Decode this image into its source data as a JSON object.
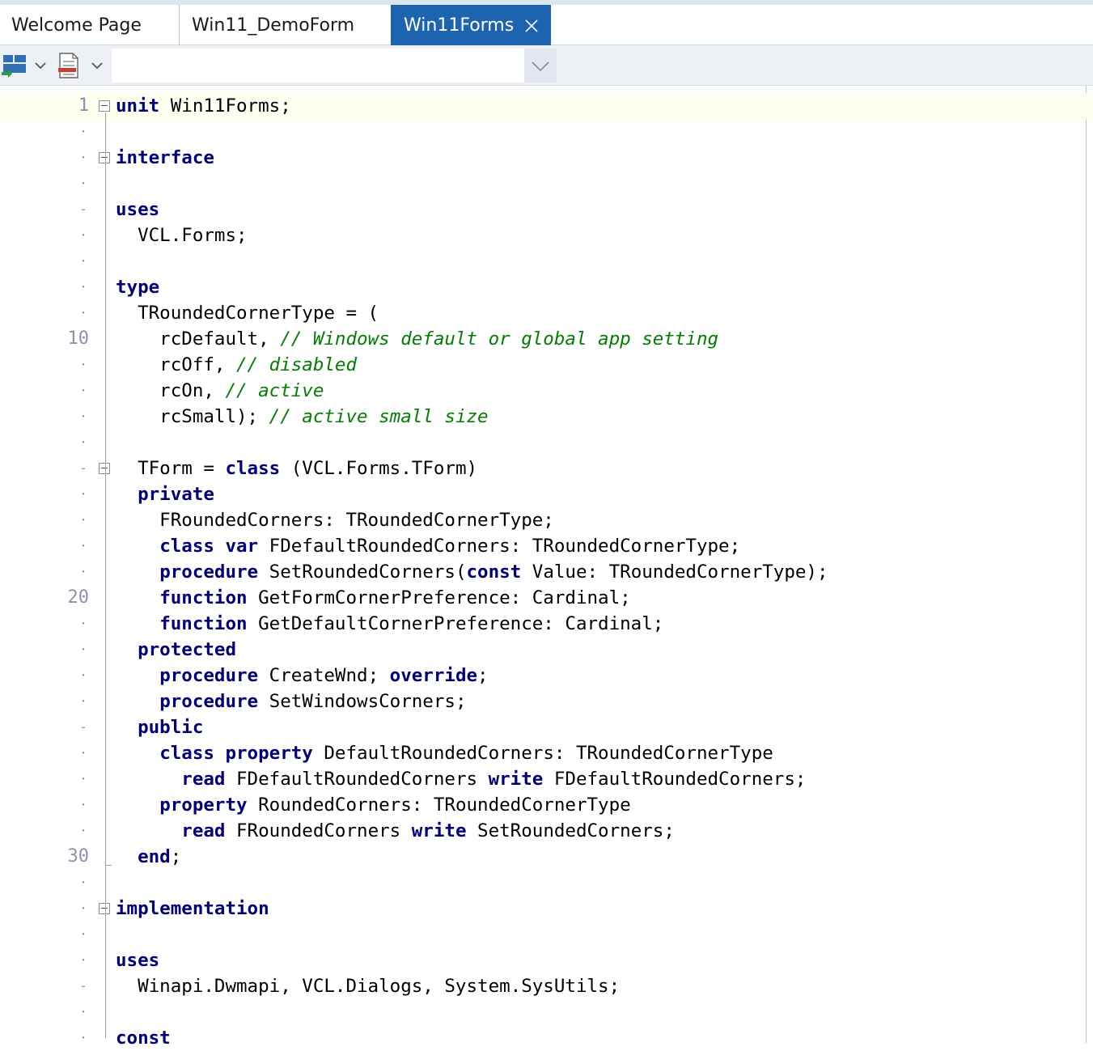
{
  "tabs": [
    {
      "label": "Welcome Page",
      "active": false
    },
    {
      "label": "Win11_DemoForm",
      "active": false
    },
    {
      "label": "Win11Forms",
      "active": true,
      "closable": true
    }
  ],
  "toolbar": {
    "buttons": [
      {
        "icon": "layout-icon",
        "dropdown": true
      },
      {
        "icon": "document-icon",
        "dropdown": true
      }
    ],
    "combo_value": ""
  },
  "editor": {
    "current_line": 1,
    "lines": [
      {
        "gutter": "1",
        "fold": "box",
        "segs": [
          {
            "t": "unit",
            "c": "kw"
          },
          {
            "t": " Win11Forms;"
          }
        ]
      },
      {
        "gutter": "·",
        "segs": []
      },
      {
        "gutter": "·",
        "fold": "box",
        "segs": [
          {
            "t": "interface",
            "c": "kw"
          }
        ]
      },
      {
        "gutter": "·",
        "segs": []
      },
      {
        "gutter": "-",
        "segs": [
          {
            "t": "uses",
            "c": "kw"
          }
        ]
      },
      {
        "gutter": "·",
        "segs": [
          {
            "t": "  VCL.Forms;"
          }
        ]
      },
      {
        "gutter": "·",
        "segs": []
      },
      {
        "gutter": "·",
        "segs": [
          {
            "t": "type",
            "c": "kw"
          }
        ]
      },
      {
        "gutter": "·",
        "segs": [
          {
            "t": "  TRoundedCornerType = ("
          }
        ]
      },
      {
        "gutter": "10",
        "segs": [
          {
            "t": "    rcDefault, "
          },
          {
            "t": "// Windows default or global app setting",
            "c": "cm"
          }
        ]
      },
      {
        "gutter": "·",
        "segs": [
          {
            "t": "    rcOff, "
          },
          {
            "t": "// disabled",
            "c": "cm"
          }
        ]
      },
      {
        "gutter": "·",
        "segs": [
          {
            "t": "    rcOn, "
          },
          {
            "t": "// active",
            "c": "cm"
          }
        ]
      },
      {
        "gutter": "·",
        "segs": [
          {
            "t": "    rcSmall); "
          },
          {
            "t": "// active small size",
            "c": "cm"
          }
        ]
      },
      {
        "gutter": "·",
        "segs": []
      },
      {
        "gutter": "-",
        "fold": "box",
        "segs": [
          {
            "t": "  TForm = "
          },
          {
            "t": "class",
            "c": "kw"
          },
          {
            "t": " (VCL.Forms.TForm)"
          }
        ]
      },
      {
        "gutter": "·",
        "segs": [
          {
            "t": "  "
          },
          {
            "t": "private",
            "c": "kw"
          }
        ]
      },
      {
        "gutter": "·",
        "segs": [
          {
            "t": "    FRoundedCorners: TRoundedCornerType;"
          }
        ]
      },
      {
        "gutter": "·",
        "segs": [
          {
            "t": "    "
          },
          {
            "t": "class var",
            "c": "kw"
          },
          {
            "t": " FDefaultRoundedCorners: TRoundedCornerType;"
          }
        ]
      },
      {
        "gutter": "·",
        "segs": [
          {
            "t": "    "
          },
          {
            "t": "procedure",
            "c": "kw"
          },
          {
            "t": " SetRoundedCorners("
          },
          {
            "t": "const",
            "c": "kw"
          },
          {
            "t": " Value: TRoundedCornerType);"
          }
        ]
      },
      {
        "gutter": "20",
        "segs": [
          {
            "t": "    "
          },
          {
            "t": "function",
            "c": "kw"
          },
          {
            "t": " GetFormCornerPreference: Cardinal;"
          }
        ]
      },
      {
        "gutter": "·",
        "segs": [
          {
            "t": "    "
          },
          {
            "t": "function",
            "c": "kw"
          },
          {
            "t": " GetDefaultCornerPreference: Cardinal;"
          }
        ]
      },
      {
        "gutter": "·",
        "segs": [
          {
            "t": "  "
          },
          {
            "t": "protected",
            "c": "kw"
          }
        ]
      },
      {
        "gutter": "·",
        "segs": [
          {
            "t": "    "
          },
          {
            "t": "procedure",
            "c": "kw"
          },
          {
            "t": " CreateWnd; "
          },
          {
            "t": "override",
            "c": "kw"
          },
          {
            "t": ";"
          }
        ]
      },
      {
        "gutter": "·",
        "segs": [
          {
            "t": "    "
          },
          {
            "t": "procedure",
            "c": "kw"
          },
          {
            "t": " SetWindowsCorners;"
          }
        ]
      },
      {
        "gutter": "-",
        "segs": [
          {
            "t": "  "
          },
          {
            "t": "public",
            "c": "kw"
          }
        ]
      },
      {
        "gutter": "·",
        "segs": [
          {
            "t": "    "
          },
          {
            "t": "class property",
            "c": "kw"
          },
          {
            "t": " DefaultRoundedCorners: TRoundedCornerType"
          }
        ]
      },
      {
        "gutter": "·",
        "segs": [
          {
            "t": "      "
          },
          {
            "t": "read",
            "c": "kw"
          },
          {
            "t": " FDefaultRoundedCorners "
          },
          {
            "t": "write",
            "c": "kw"
          },
          {
            "t": " FDefaultRoundedCorners;"
          }
        ]
      },
      {
        "gutter": "·",
        "segs": [
          {
            "t": "    "
          },
          {
            "t": "property",
            "c": "kw"
          },
          {
            "t": " RoundedCorners: TRoundedCornerType"
          }
        ]
      },
      {
        "gutter": "·",
        "segs": [
          {
            "t": "      "
          },
          {
            "t": "read",
            "c": "kw"
          },
          {
            "t": " FRoundedCorners "
          },
          {
            "t": "write",
            "c": "kw"
          },
          {
            "t": " SetRoundedCorners;"
          }
        ]
      },
      {
        "gutter": "30",
        "fold": "end",
        "segs": [
          {
            "t": "  "
          },
          {
            "t": "end",
            "c": "kw"
          },
          {
            "t": ";"
          }
        ]
      },
      {
        "gutter": "·",
        "segs": []
      },
      {
        "gutter": "·",
        "fold": "box",
        "segs": [
          {
            "t": "implementation",
            "c": "kw"
          }
        ]
      },
      {
        "gutter": "·",
        "segs": []
      },
      {
        "gutter": "·",
        "segs": [
          {
            "t": "uses",
            "c": "kw"
          }
        ]
      },
      {
        "gutter": "-",
        "segs": [
          {
            "t": "  Winapi.Dwmapi, VCL.Dialogs, System.SysUtils;"
          }
        ]
      },
      {
        "gutter": "·",
        "segs": []
      },
      {
        "gutter": "·",
        "segs": [
          {
            "t": "const",
            "c": "kw"
          }
        ]
      }
    ]
  }
}
